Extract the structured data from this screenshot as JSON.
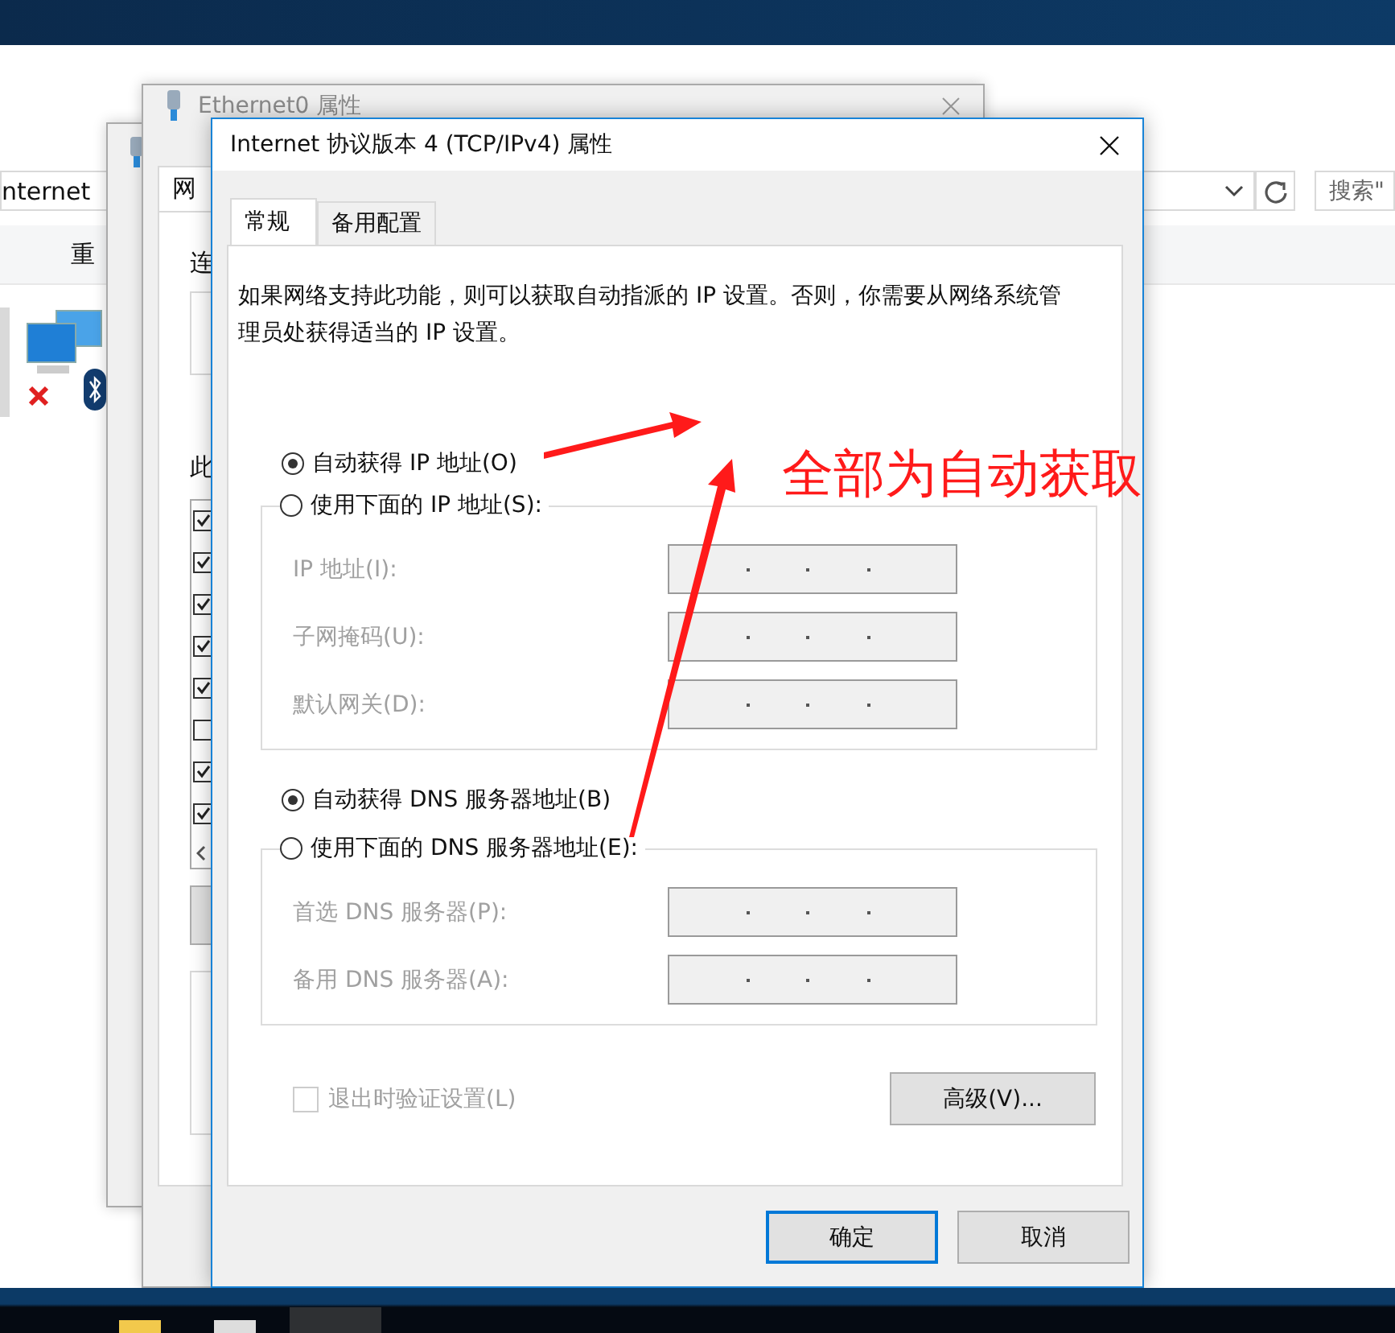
{
  "explorer": {
    "address": "nternet",
    "search_placeholder": "搜索\"",
    "toolbar": [
      "重"
    ]
  },
  "ethernet_window": {
    "title": "Ethernet0 属性",
    "tab": "网",
    "labels": [
      "连",
      "此"
    ],
    "list_checks": [
      {
        "checked": true
      },
      {
        "checked": true
      },
      {
        "checked": true
      },
      {
        "checked": true
      },
      {
        "checked": true
      },
      {
        "checked": false
      },
      {
        "checked": true
      },
      {
        "checked": true
      }
    ]
  },
  "dialog": {
    "title": "Internet 协议版本 4 (TCP/IPv4) 属性",
    "tabs": [
      {
        "label": "常规",
        "selected": true
      },
      {
        "label": "备用配置",
        "selected": false
      }
    ],
    "description": "如果网络支持此功能，则可以获取自动指派的 IP 设置。否则，你需要从网络系统管理员处获得适当的 IP 设置。",
    "sections": [
      {
        "auto_option": {
          "label": "自动获得 IP 地址(O)",
          "selected": true
        },
        "manual_option": {
          "label": "使用下面的 IP 地址(S):",
          "selected": false
        },
        "fields": [
          {
            "label": "IP 地址(I):",
            "disabled": true
          },
          {
            "label": "子网掩码(U):",
            "disabled": true
          },
          {
            "label": "默认网关(D):",
            "disabled": true
          }
        ]
      },
      {
        "auto_option": {
          "label": "自动获得 DNS 服务器地址(B)",
          "selected": true
        },
        "manual_option": {
          "label": "使用下面的 DNS 服务器地址(E):",
          "selected": false
        },
        "fields": [
          {
            "label": "首选 DNS 服务器(P):",
            "disabled": true
          },
          {
            "label": "备用 DNS 服务器(A):",
            "disabled": true
          }
        ]
      }
    ],
    "validate_checkbox": {
      "label": "退出时验证设置(L)",
      "checked": false,
      "disabled": true
    },
    "advanced_button": "高级(V)...",
    "buttons": [
      {
        "label": "确定",
        "default": true
      },
      {
        "label": "取消",
        "default": false
      }
    ]
  },
  "annotation": {
    "text": "全部为自动获取"
  }
}
